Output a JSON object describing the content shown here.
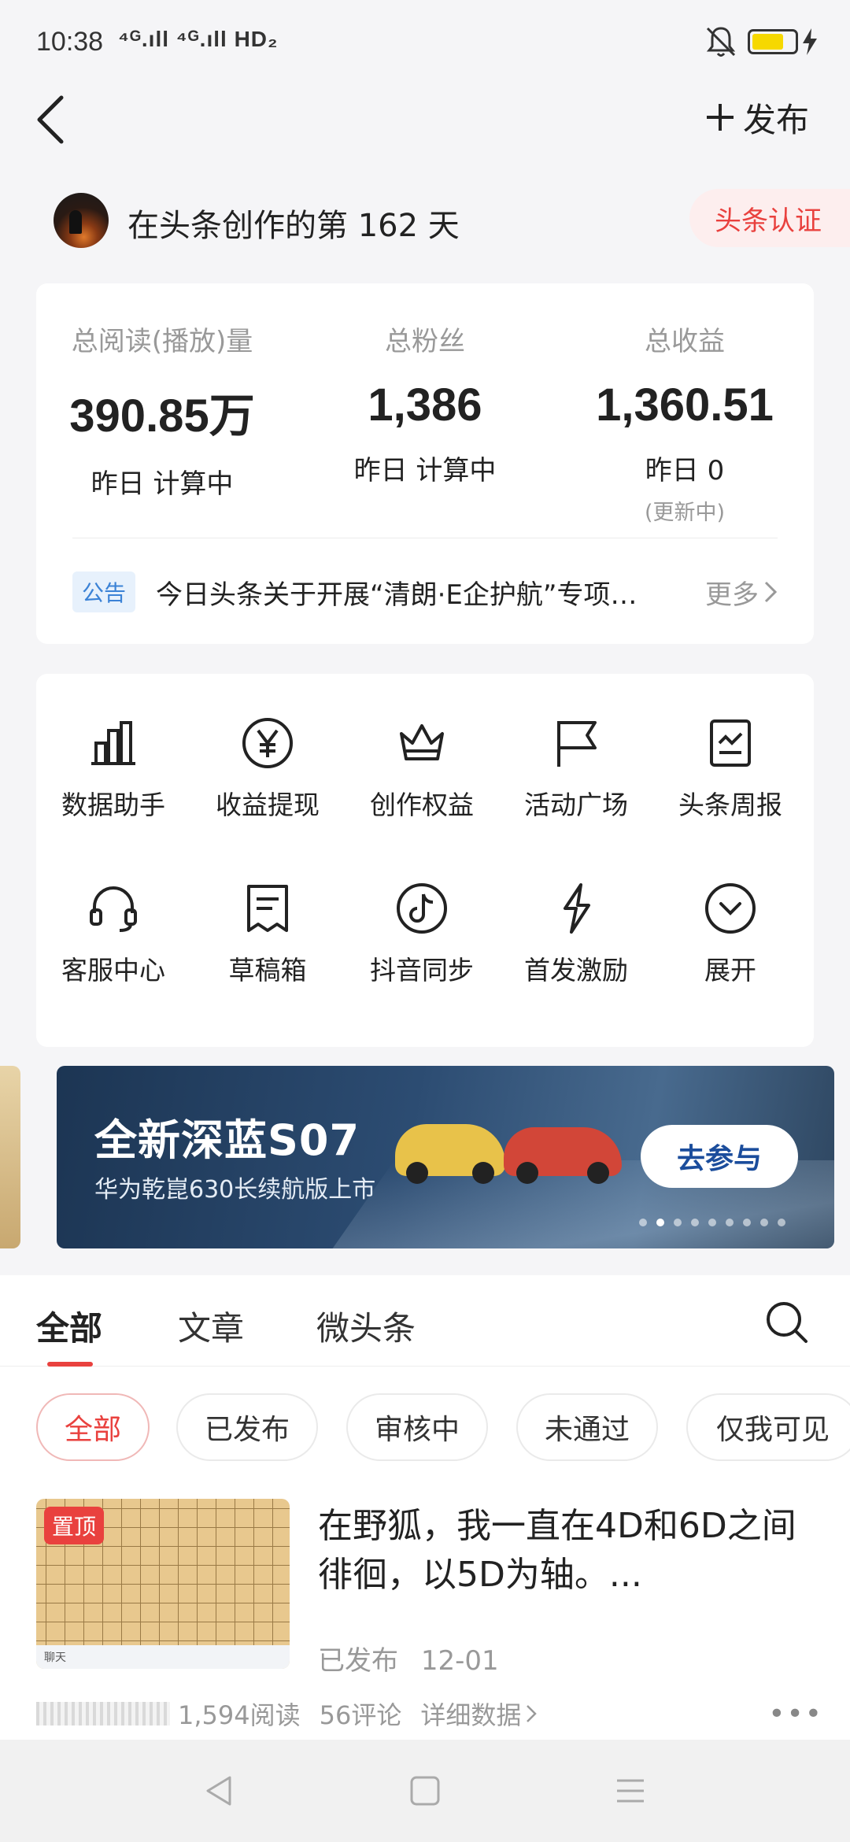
{
  "status_bar": {
    "time": "10:38",
    "signal": "⁴ᴳ.ıll ⁴ᴳ.ıll HD₂",
    "battery_color": "#f6d800",
    "battery_level": 0.75,
    "icons": [
      "mute-icon",
      "battery-icon",
      "charging-icon"
    ]
  },
  "header": {
    "publish_label": "发布"
  },
  "profile": {
    "text": "在头条创作的第 162 天",
    "cert_label": "头条认证"
  },
  "stats": [
    {
      "label": "总阅读(播放)量",
      "value": "390.85万",
      "sub": "昨日 计算中",
      "sub2": ""
    },
    {
      "label": "总粉丝",
      "value": "1,386",
      "sub": "昨日 计算中",
      "sub2": ""
    },
    {
      "label": "总收益",
      "value": "1,360.51",
      "sub": "昨日 0",
      "sub2": "(更新中)"
    }
  ],
  "notice": {
    "tag": "公告",
    "text": "今日头条关于开展“清朗·E企护航”专项…",
    "more": "更多"
  },
  "tools": [
    {
      "label": "数据助手",
      "icon": "bar-chart-icon"
    },
    {
      "label": "收益提现",
      "icon": "yen-icon"
    },
    {
      "label": "创作权益",
      "icon": "crown-icon"
    },
    {
      "label": "活动广场",
      "icon": "flag-icon"
    },
    {
      "label": "头条周报",
      "icon": "report-icon"
    },
    {
      "label": "客服中心",
      "icon": "headset-icon"
    },
    {
      "label": "草稿箱",
      "icon": "draft-icon"
    },
    {
      "label": "抖音同步",
      "icon": "douyin-icon"
    },
    {
      "label": "首发激励",
      "icon": "lightning-icon"
    },
    {
      "label": "展开",
      "icon": "expand-icon"
    }
  ],
  "banner": {
    "title": "全新深蓝S07",
    "subtitle": "华为乾崑630长续航版上市",
    "button": "去参与",
    "dot_count": 9,
    "active_dot": 1
  },
  "content_tabs": [
    "全部",
    "文章",
    "微头条"
  ],
  "filters": [
    "全部",
    "已发布",
    "审核中",
    "未通过",
    "仅我可见"
  ],
  "article": {
    "badge": "置顶",
    "thumb_label": "聊天",
    "title": "在野狐，我一直在4D和6D之间徘徊，以5D为轴。...",
    "status": "已发布",
    "date": "12-01",
    "reads": "1,594阅读",
    "comments": "56评论",
    "details": "详细数据"
  },
  "colors": {
    "accent_red": "#e9413e",
    "notice_blue": "#3b82d6",
    "banner_button_text": "#1b4d9c"
  }
}
